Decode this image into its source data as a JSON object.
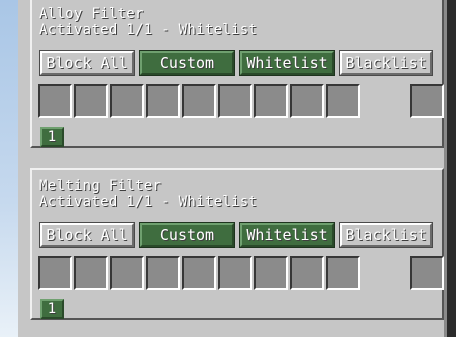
{
  "filters": [
    {
      "title": "Alloy Filter",
      "status": "Activated 1/1 - Whitelist",
      "buttons": [
        {
          "label": "Block All",
          "active": false
        },
        {
          "label": "Custom",
          "active": true
        },
        {
          "label": "Whitelist",
          "active": true
        },
        {
          "label": "Blacklist",
          "active": false
        }
      ],
      "page": "1"
    },
    {
      "title": "Melting Filter",
      "status": "Activated 1/1 - Whitelist",
      "buttons": [
        {
          "label": "Block All",
          "active": false
        },
        {
          "label": "Custom",
          "active": true
        },
        {
          "label": "Whitelist",
          "active": true
        },
        {
          "label": "Blacklist",
          "active": false
        }
      ],
      "page": "1"
    }
  ],
  "colors": {
    "panel_bg": "#c6c6c6",
    "active_button": "#3f6d3f",
    "slot_bg": "#8b8b8b",
    "text": "#ffffff"
  }
}
